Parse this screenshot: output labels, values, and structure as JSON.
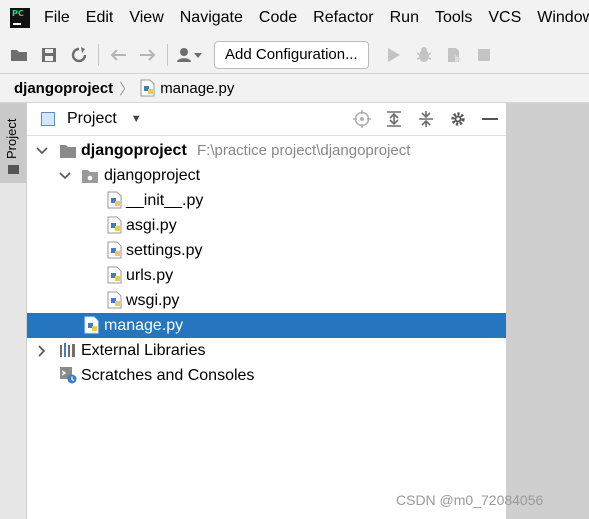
{
  "menubar": {
    "items": [
      "File",
      "Edit",
      "View",
      "Navigate",
      "Code",
      "Refactor",
      "Run",
      "Tools",
      "VCS",
      "Window"
    ]
  },
  "toolbar": {
    "add_configuration": "Add Configuration..."
  },
  "breadcrumb": {
    "root": "djangoproject",
    "file": "manage.py"
  },
  "side_strip": {
    "tab_label": "Project"
  },
  "project_panel": {
    "title": "Project"
  },
  "tree": {
    "root": {
      "name": "djangoproject",
      "path": "F:\\practice project\\djangoproject"
    },
    "package": {
      "name": "djangoproject"
    },
    "files": [
      "__init__.py",
      "asgi.py",
      "settings.py",
      "urls.py",
      "wsgi.py"
    ],
    "manage": {
      "name": "manage.py"
    },
    "external_libraries": "External Libraries",
    "scratches": "Scratches and Consoles"
  },
  "watermark": "CSDN @m0_72084056",
  "colors": {
    "selection": "#2675bf",
    "python_blue": "#3f7cc0",
    "python_yellow": "#f2c94c",
    "folder_gray": "#8a8a8a"
  }
}
